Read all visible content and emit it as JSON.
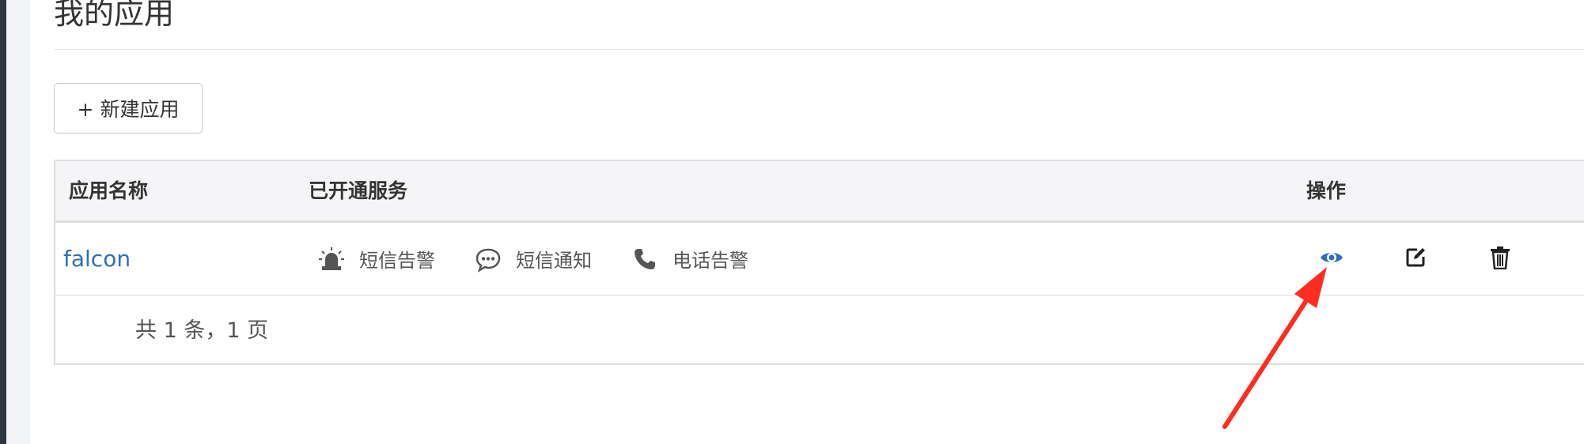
{
  "page": {
    "title": "我的应用"
  },
  "toolbar": {
    "new_app_label": "+ 新建应用"
  },
  "table": {
    "headers": {
      "name": "应用名称",
      "services": "已开通服务",
      "actions": "操作"
    },
    "rows": [
      {
        "name": "falcon",
        "services": [
          {
            "label": "短信告警",
            "icon": "alarm-light-icon"
          },
          {
            "label": "短信通知",
            "icon": "chat-bubble-icon"
          },
          {
            "label": "电话告警",
            "icon": "phone-icon"
          }
        ],
        "actions": [
          "view-icon",
          "edit-icon",
          "delete-icon"
        ]
      }
    ],
    "footer": "共 1 条，1 页"
  },
  "colors": {
    "link": "#2f6fb8",
    "view_icon": "#2f6fb8",
    "annotation_arrow": "#ff2d20"
  }
}
